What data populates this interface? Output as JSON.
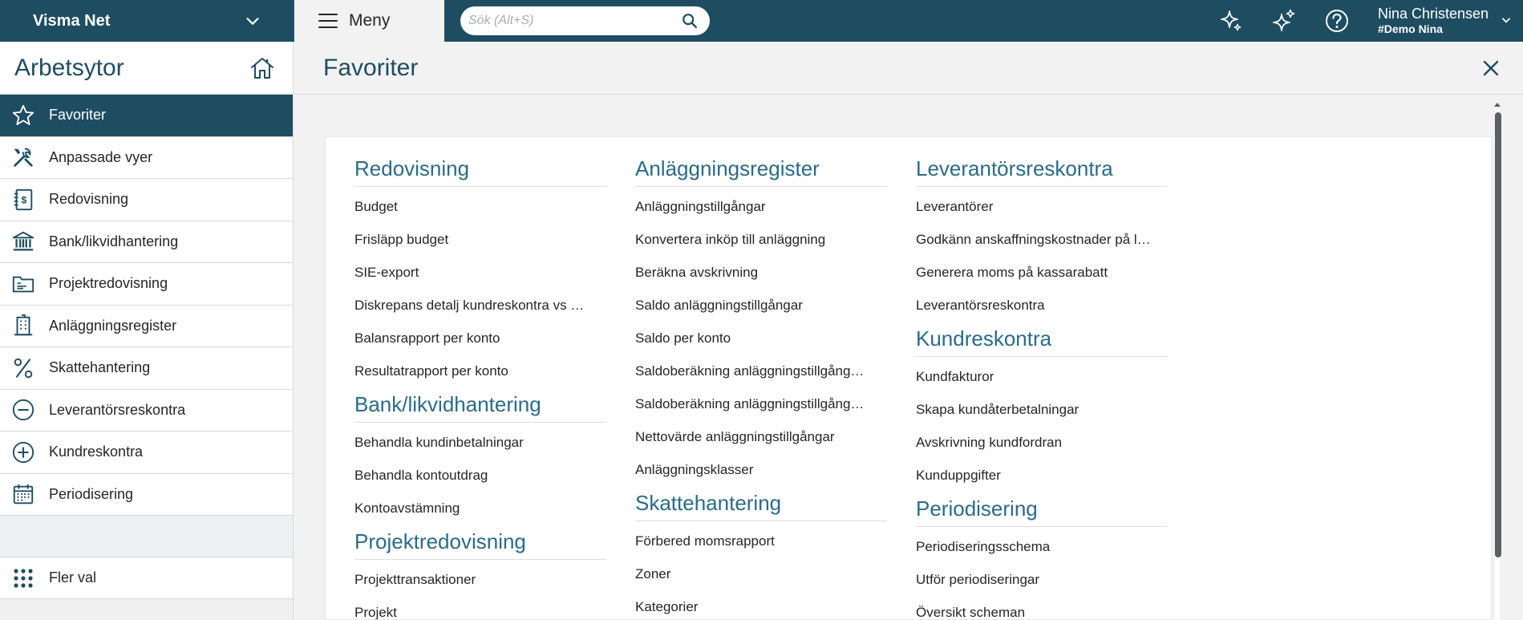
{
  "topbar": {
    "company": "Visma Net",
    "menu_label": "Meny",
    "search_placeholder": "Sök (Alt+S)",
    "user_name": "Nina Christensen",
    "user_company": "#Demo Nina"
  },
  "sidebar": {
    "title": "Arbetsytor",
    "items": [
      {
        "label": "Favoriter",
        "icon": "star-icon"
      },
      {
        "label": "Anpassade vyer",
        "icon": "tools-icon"
      },
      {
        "label": "Redovisning",
        "icon": "ledger-icon"
      },
      {
        "label": "Bank/likvidhantering",
        "icon": "bank-icon"
      },
      {
        "label": "Projektredovisning",
        "icon": "folder-icon"
      },
      {
        "label": "Anläggningsregister",
        "icon": "building-icon"
      },
      {
        "label": "Skattehantering",
        "icon": "percent-icon"
      },
      {
        "label": "Leverantörsreskontra",
        "icon": "minus-circle-icon"
      },
      {
        "label": "Kundreskontra",
        "icon": "plus-circle-icon"
      },
      {
        "label": "Periodisering",
        "icon": "calendar-icon"
      }
    ],
    "more_label": "Fler val"
  },
  "main": {
    "title": "Favoriter",
    "columns": [
      [
        {
          "title": "Redovisning",
          "links": [
            "Budget",
            "Frisläpp budget",
            "SIE-export",
            "Diskrepans detalj kundreskontra vs …",
            "Balansrapport per konto",
            "Resultatrapport per konto"
          ]
        },
        {
          "title": "Bank/likvidhantering",
          "links": [
            "Behandla kundinbetalningar",
            "Behandla kontoutdrag",
            "Kontoavstämning"
          ]
        },
        {
          "title": "Projektredovisning",
          "links": [
            "Projekttransaktioner",
            "Projekt"
          ]
        }
      ],
      [
        {
          "title": "Anläggningsregister",
          "links": [
            "Anläggningstillgångar",
            "Konvertera inköp till anläggning",
            "Beräkna avskrivning",
            "Saldo anläggningstillgångar",
            "Saldo per konto",
            "Saldoberäkning anläggningstillgång…",
            "Saldoberäkning anläggningstillgång…",
            "Nettovärde anläggningstillgångar",
            "Anläggningsklasser"
          ]
        },
        {
          "title": "Skattehantering",
          "links": [
            "Förbered momsrapport",
            "Zoner",
            "Kategorier"
          ]
        }
      ],
      [
        {
          "title": "Leverantörsreskontra",
          "links": [
            "Leverantörer",
            "Godkänn anskaffningskostnader på l…",
            "Generera moms på kassarabatt",
            "Leverantörsreskontra"
          ]
        },
        {
          "title": "Kundreskontra",
          "links": [
            "Kundfakturor",
            "Skapa kundåterbetalningar",
            "Avskrivning kundfordran",
            "Kunduppgifter"
          ]
        },
        {
          "title": "Periodisering",
          "links": [
            "Periodiseringsschema",
            "Utför periodiseringar",
            "Översikt scheman"
          ]
        }
      ]
    ]
  }
}
